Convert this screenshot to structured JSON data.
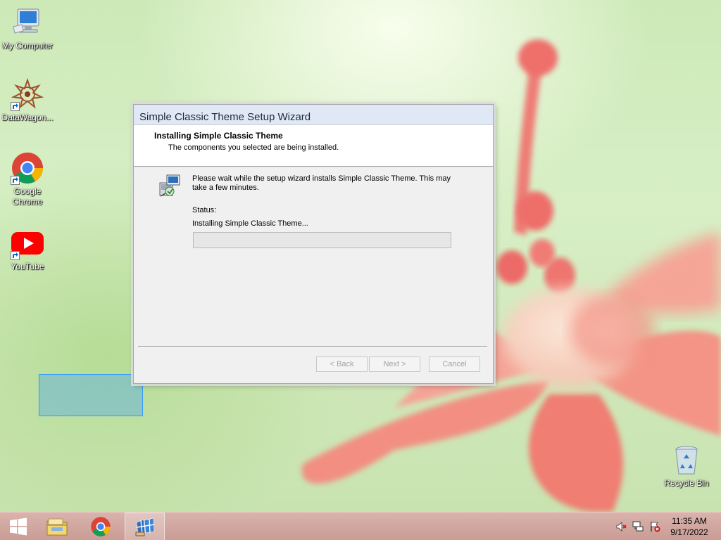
{
  "desktop": {
    "icons": [
      {
        "name": "my-computer",
        "label": "My Computer"
      },
      {
        "name": "datawagon",
        "label": "DataWagon..."
      },
      {
        "name": "google-chrome",
        "label": "Google Chrome"
      },
      {
        "name": "youtube",
        "label": "YouTube"
      },
      {
        "name": "recycle-bin",
        "label": "Recycle Bin"
      }
    ]
  },
  "wizard": {
    "title": "Simple Classic Theme Setup Wizard",
    "header_title": "Installing Simple Classic Theme",
    "header_subtitle": "The components you selected are being installed.",
    "message": "Please wait while the setup wizard installs Simple Classic Theme. This may take a few minutes.",
    "status_label": "Status:",
    "status_text": "Installing Simple Classic Theme...",
    "progress": 0,
    "buttons": {
      "back": "< Back",
      "next": "Next >",
      "cancel": "Cancel"
    }
  },
  "taskbar": {
    "pinned": [
      "start-icon",
      "file-explorer-icon",
      "chrome-icon",
      "setup-wizard-icon"
    ],
    "tray_icons": [
      "volume-muted-icon",
      "network-icon",
      "action-center-icon"
    ],
    "time": "11:35 AM",
    "date": "9/17/2022"
  },
  "colors": {
    "taskbar": "#c99c94",
    "title_bar": "#dfe8f4",
    "selection": "#3399ff"
  }
}
